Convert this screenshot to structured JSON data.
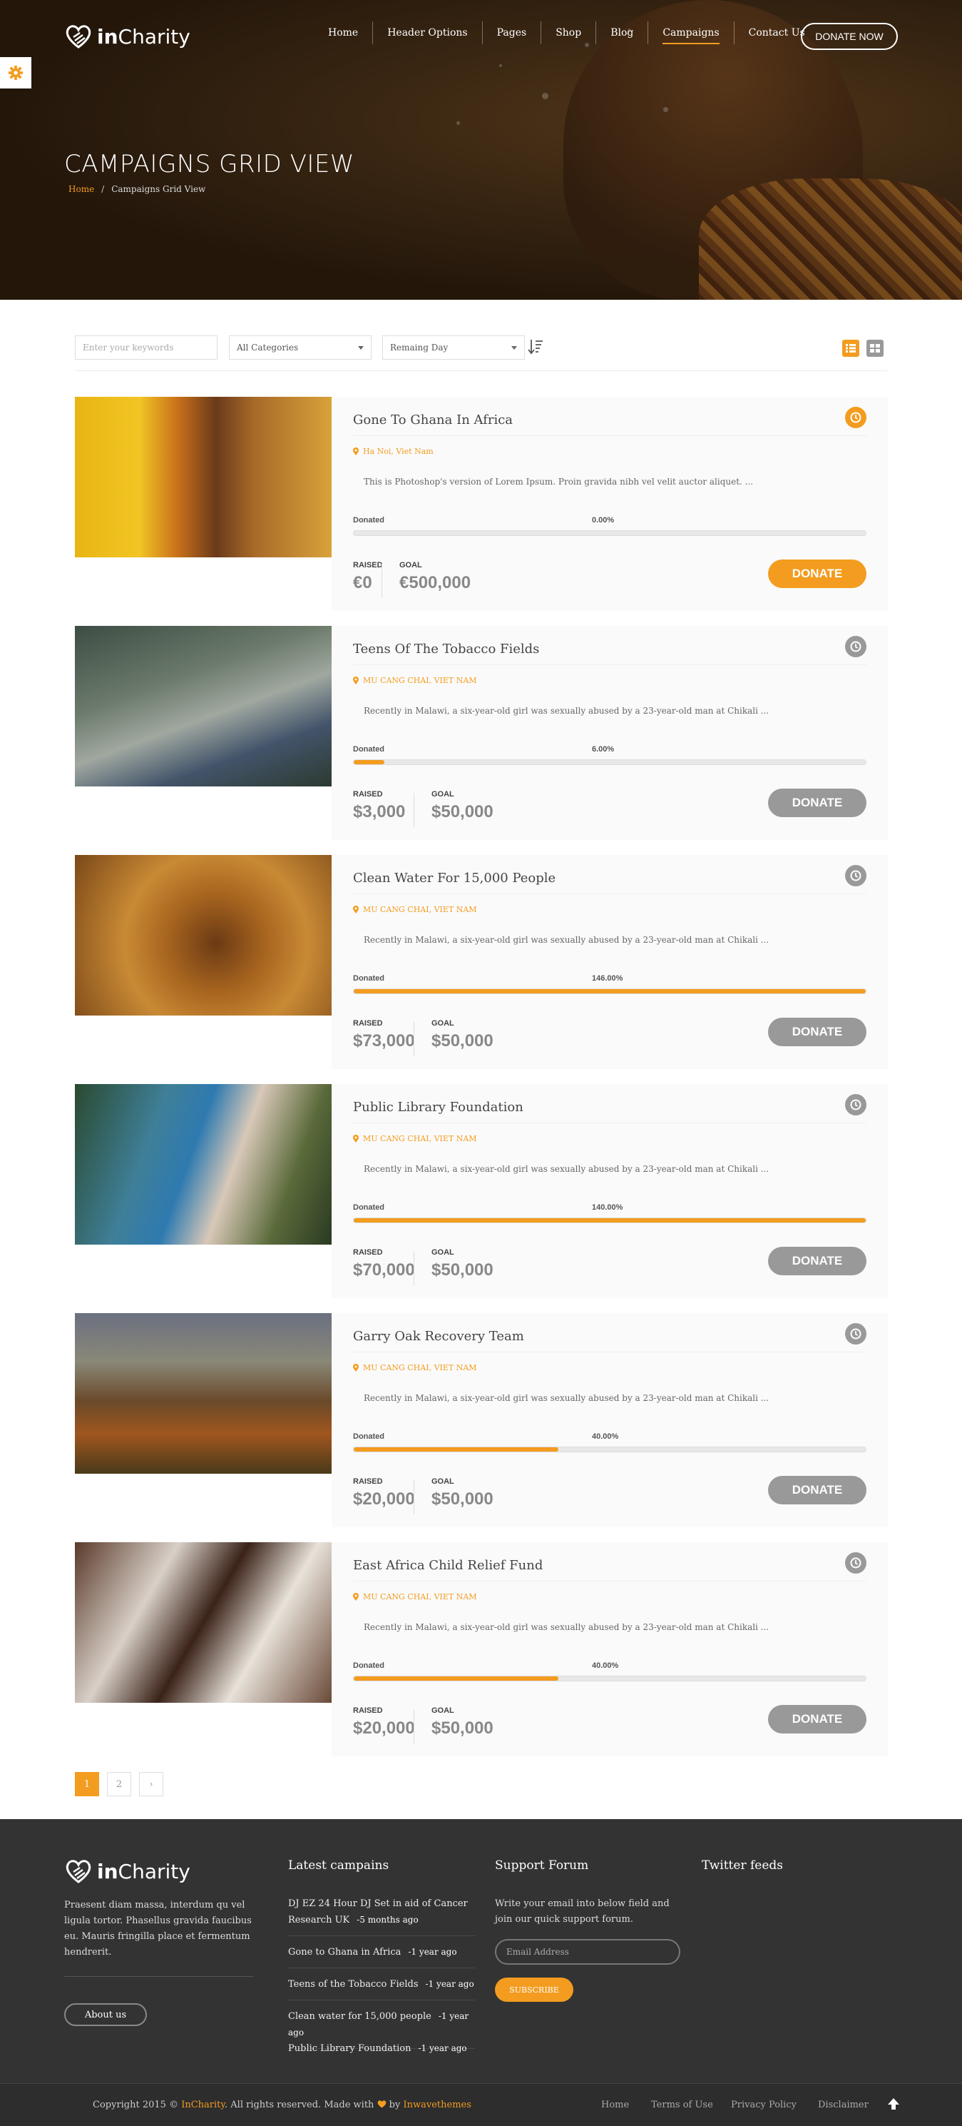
{
  "header": {
    "logo": {
      "bold": "in",
      "rest": "Charity"
    },
    "nav": [
      "Home",
      "Header Options",
      "Pages",
      "Shop",
      "Blog",
      "Campaigns",
      "Contact Us"
    ],
    "active_nav": "Campaigns",
    "cta": "DONATE NOW"
  },
  "hero": {
    "title": "CAMPAIGNS GRID VIEW",
    "breadcrumb": {
      "home": "Home",
      "sep": "/",
      "current": "Campaigns Grid View"
    }
  },
  "filters": {
    "keyword_placeholder": "Enter your keywords",
    "category": "All Categories",
    "sort": "Remaing Day"
  },
  "accent_color": "#f39c1f",
  "inactive_button_color": "#999999",
  "campaigns": [
    {
      "title": "Gone To Ghana In Africa",
      "location": "Ha Noi, Viet Nam",
      "desc": "This is Photoshop's version of Lorem Ipsum. Proin gravida nibh vel velit auctor aliquet. ...",
      "donated_label": "Donated",
      "percent_text": "0.00%",
      "progress": 0,
      "raised_label": "RAISED",
      "raised": "€0",
      "goal_label": "GOAL",
      "goal": "€500,000",
      "button": "DONATE",
      "featured": true
    },
    {
      "title": "Teens Of The Tobacco Fields",
      "location": "MU CANG CHAI, VIET NAM",
      "desc": "Recently in Malawi, a six-year-old girl was sexually abused by a 23-year-old man at Chikali ...",
      "donated_label": "Donated",
      "percent_text": "6.00%",
      "progress": 6,
      "raised_label": "RAISED",
      "raised": "$3,000",
      "goal_label": "GOAL",
      "goal": "$50,000",
      "button": "DONATE",
      "featured": false
    },
    {
      "title": "Clean Water For 15,000 People",
      "location": "MU CANG CHAI, VIET NAM",
      "desc": "Recently in Malawi, a six-year-old girl was sexually abused by a 23-year-old man at Chikali ...",
      "donated_label": "Donated",
      "percent_text": "146.00%",
      "progress": 100,
      "raised_label": "RAISED",
      "raised": "$73,000",
      "goal_label": "GOAL",
      "goal": "$50,000",
      "button": "DONATE",
      "featured": false
    },
    {
      "title": "Public Library Foundation",
      "location": "MU CANG CHAI, VIET NAM",
      "desc": "Recently in Malawi, a six-year-old girl was sexually abused by a 23-year-old man at Chikali ...",
      "donated_label": "Donated",
      "percent_text": "140.00%",
      "progress": 100,
      "raised_label": "RAISED",
      "raised": "$70,000",
      "goal_label": "GOAL",
      "goal": "$50,000",
      "button": "DONATE",
      "featured": false
    },
    {
      "title": "Garry Oak Recovery Team",
      "location": "MU CANG CHAI, VIET NAM",
      "desc": "Recently in Malawi, a six-year-old girl was sexually abused by a 23-year-old man at Chikali ...",
      "donated_label": "Donated",
      "percent_text": "40.00%",
      "progress": 40,
      "raised_label": "RAISED",
      "raised": "$20,000",
      "goal_label": "GOAL",
      "goal": "$50,000",
      "button": "DONATE",
      "featured": false
    },
    {
      "title": "East Africa Child Relief Fund",
      "location": "MU CANG CHAI, VIET NAM",
      "desc": "Recently in Malawi, a six-year-old girl was sexually abused by a 23-year-old man at Chikali ...",
      "donated_label": "Donated",
      "percent_text": "40.00%",
      "progress": 40,
      "raised_label": "RAISED",
      "raised": "$20,000",
      "goal_label": "GOAL",
      "goal": "$50,000",
      "button": "DONATE",
      "featured": false
    }
  ],
  "pagination": {
    "pages": [
      "1",
      "2"
    ],
    "current": "1",
    "next": "›"
  },
  "footer": {
    "about_text": "Praesent diam massa, interdum qu vel ligula tortor. Phasellus gravida faucibus eu. Mauris fringilla place et fermentum hendrerit.",
    "about_button": "About us",
    "latest_title": "Latest campains",
    "latest": [
      {
        "title": "DJ EZ 24 Hour DJ Set in aid of Cancer Research UK",
        "ago": "-5 months ago"
      },
      {
        "title": "Gone to Ghana in Africa",
        "ago": "-1 year ago"
      },
      {
        "title": "Teens of the Tobacco Fields",
        "ago": "-1 year ago"
      },
      {
        "title": "Clean water for 15,000 people",
        "ago": "-1 year ago"
      },
      {
        "title": "Public Library Foundation",
        "ago": "-1 year ago"
      }
    ],
    "forum_title": "Support Forum",
    "forum_text": "Write your email into below field and join our quick support forum.",
    "email_placeholder": "Email Address",
    "subscribe": "SUBSCRIBE",
    "twitter_title": "Twitter feeds"
  },
  "bottom": {
    "copy_pre": "Copyright 2015 © ",
    "brand": "InCharity",
    "copy_mid": ". All rights reserved. Made with ",
    "copy_by": " by ",
    "author": "Inwavethemes",
    "links": [
      "Home",
      "Terms of Use",
      "Privacy Policy",
      "Disclaimer"
    ]
  }
}
